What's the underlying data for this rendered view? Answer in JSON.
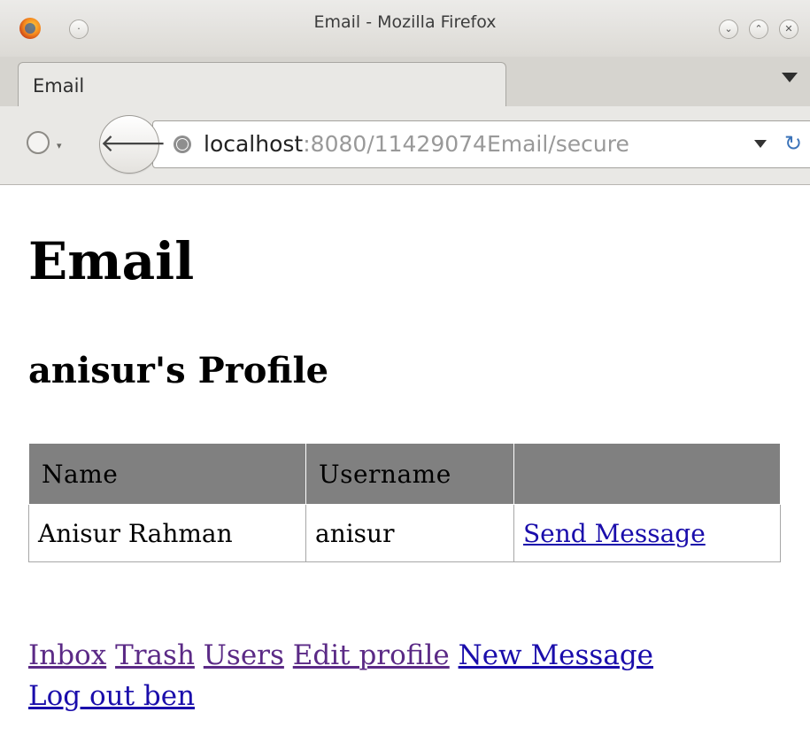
{
  "window": {
    "title": "Email - Mozilla Firefox",
    "buttons": [
      "minimize-icon",
      "maximize-icon",
      "close-icon"
    ]
  },
  "tab": {
    "label": "Email"
  },
  "navbar": {
    "url_host": "localhost",
    "url_rest": ":8080/11429074Email/secure"
  },
  "page": {
    "title": "Email",
    "subtitle": "anisur's Profile",
    "table": {
      "headers": [
        "Name",
        "Username",
        ""
      ],
      "rows": [
        {
          "name": "Anisur Rahman",
          "username": "anisur",
          "action": "Send Message"
        }
      ]
    },
    "links": [
      {
        "label": "Inbox",
        "visited": true
      },
      {
        "label": "Trash",
        "visited": true
      },
      {
        "label": "Users",
        "visited": true
      },
      {
        "label": "Edit profile",
        "visited": true
      },
      {
        "label": "New Message",
        "visited": false
      },
      {
        "label": "Log out ben",
        "visited": false
      }
    ]
  },
  "colors": {
    "header_bg": "#808080",
    "link": "#1a0dab",
    "visited_link": "#5b2a86"
  }
}
